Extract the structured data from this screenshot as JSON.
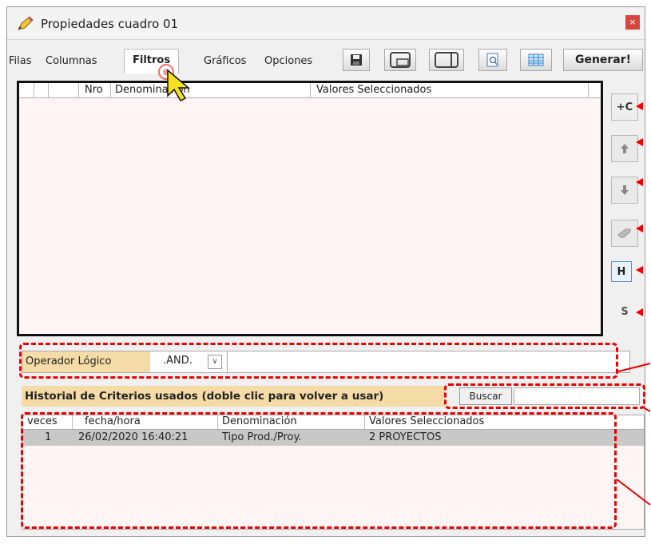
{
  "window": {
    "title": "Propiedades cuadro 01",
    "close_label": "×"
  },
  "tabs": [
    {
      "label": "Filas"
    },
    {
      "label": "Columnas"
    },
    {
      "label": "Filtros"
    },
    {
      "label": "Gráficos"
    },
    {
      "label": "Opciones"
    }
  ],
  "toolbar": {
    "generate_label": "Generar!"
  },
  "filter_grid": {
    "columns": [
      "Nro",
      "Denominación",
      "Valores Seleccionados"
    ]
  },
  "side_buttons": {
    "add_label": "+C",
    "h_label": "H",
    "s_label": "S"
  },
  "logic_operator": {
    "label": "Operador Lógico",
    "value": ".AND."
  },
  "history": {
    "title": "Historial de Criterios usados  (doble clic para volver a usar)",
    "search_label": "Buscar",
    "columns": [
      "veces",
      "fecha/hora",
      "Denominación",
      "Valores Seleccionados"
    ],
    "rows": [
      {
        "veces": "1",
        "fecha": "26/02/2020 16:40:21",
        "denominacion": "Tipo Prod./Proy.",
        "valores": "2 PROYECTOS"
      }
    ]
  },
  "colors": {
    "accent_red": "#e00000",
    "label_bg": "#f5dca7",
    "grid_bg": "#fff5f5",
    "close_red": "#d9453c"
  }
}
